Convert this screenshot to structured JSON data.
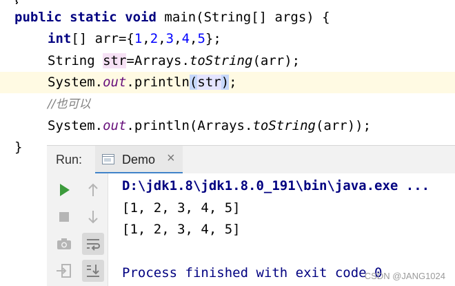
{
  "editor": {
    "line_open": {
      "kw1": "public",
      "kw2": "static",
      "kw3": "void",
      "rest": " main(String[] args) {"
    },
    "line_arr": {
      "kw": "int",
      "a": "[] arr={",
      "n1": "1",
      "c1": ",",
      "n2": "2",
      "c2": ",",
      "n3": "3",
      "c3": ",",
      "n4": "4",
      "c4": ",",
      "n5": "5",
      "end": "};"
    },
    "line_str": {
      "a": "String ",
      "var": "str",
      "b": "=Arrays.",
      "method": "toString",
      "c": "(arr);"
    },
    "line_print1": {
      "a": "System.",
      "fld": "out",
      "b": ".println",
      "p1": "(",
      "arg": "str",
      "p2": ")",
      "end": ";"
    },
    "line_comment": "//也可以",
    "line_print2": {
      "a": "System.",
      "fld": "out",
      "b": ".println(Arrays.",
      "method": "toString",
      "c": "(arr));"
    },
    "line_close": "}"
  },
  "run_panel": {
    "label": "Run:",
    "tab_name": "Demo",
    "tab_close": "×",
    "console": [
      "D:\\jdk1.8\\jdk1.8.0_191\\bin\\java.exe ...",
      "[1, 2, 3, 4, 5]",
      "[1, 2, 3, 4, 5]",
      "Process finished with exit code 0"
    ]
  },
  "watermark": "CSDN @JANG1024",
  "colors": {
    "keyword": "#000080",
    "number": "#0000ff",
    "field": "#660e7a",
    "comment": "#808080",
    "run_green": "#3c9b3c",
    "tab_underline": "#4083c9"
  }
}
